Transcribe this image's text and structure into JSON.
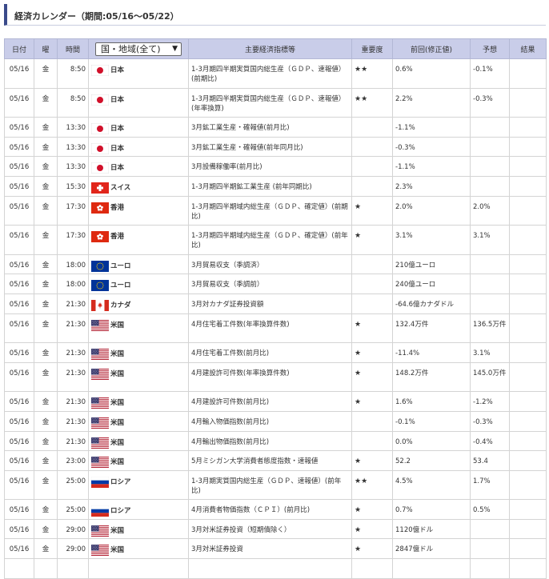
{
  "title": "経済カレンダー（期間:05/16〜05/22）",
  "headers": {
    "date": "日付",
    "dow": "曜",
    "time": "時間",
    "region_select": "国・地域(全て)",
    "indicator": "主要経済指標等",
    "importance": "重要度",
    "previous": "前回(修正値)",
    "forecast": "予想",
    "result": "結果"
  },
  "rows": [
    {
      "date": "05/16",
      "dow": "金",
      "time": "8:50",
      "flag": "japan-flag",
      "country": "日本",
      "indicator": "1-3月期四半期実質国内総生産（ＧＤＰ、速報値）(前期比)",
      "importance": "★★",
      "previous": "0.6%",
      "forecast": "-0.1%",
      "result": ""
    },
    {
      "date": "05/16",
      "dow": "金",
      "time": "8:50",
      "flag": "japan-flag",
      "country": "日本",
      "indicator": "1-3月期四半期実質国内総生産（ＧＤＰ、速報値）(年率換算)",
      "importance": "★★",
      "previous": "2.2%",
      "forecast": "-0.3%",
      "result": ""
    },
    {
      "date": "05/16",
      "dow": "金",
      "time": "13:30",
      "flag": "japan-flag",
      "country": "日本",
      "indicator": "3月鉱工業生産・確報値(前月比)",
      "importance": "",
      "previous": "-1.1%",
      "forecast": "",
      "result": ""
    },
    {
      "date": "05/16",
      "dow": "金",
      "time": "13:30",
      "flag": "japan-flag",
      "country": "日本",
      "indicator": "3月鉱工業生産・確報値(前年同月比)",
      "importance": "",
      "previous": "-0.3%",
      "forecast": "",
      "result": ""
    },
    {
      "date": "05/16",
      "dow": "金",
      "time": "13:30",
      "flag": "japan-flag",
      "country": "日本",
      "indicator": "3月設備稼働率(前月比)",
      "importance": "",
      "previous": "-1.1%",
      "forecast": "",
      "result": ""
    },
    {
      "date": "05/16",
      "dow": "金",
      "time": "15:30",
      "flag": "switzerland-flag",
      "country": "スイス",
      "indicator": "1-3月期四半期鉱工業生産 (前年同期比)",
      "importance": "",
      "previous": "2.3%",
      "forecast": "",
      "result": ""
    },
    {
      "date": "05/16",
      "dow": "金",
      "time": "17:30",
      "flag": "hong-kong-flag",
      "country": "香港",
      "indicator": "1-3月期四半期域内総生産（ＧＤＰ、確定値）(前期比)",
      "importance": "★",
      "previous": "2.0%",
      "forecast": "2.0%",
      "result": ""
    },
    {
      "date": "05/16",
      "dow": "金",
      "time": "17:30",
      "flag": "hong-kong-flag",
      "country": "香港",
      "indicator": "1-3月期四半期域内総生産（ＧＤＰ、確定値）(前年比)",
      "importance": "★",
      "previous": "3.1%",
      "forecast": "3.1%",
      "result": ""
    },
    {
      "date": "05/16",
      "dow": "金",
      "time": "18:00",
      "flag": "eu-flag",
      "country": "ユーロ",
      "indicator": "3月貿易収支（季調済）",
      "importance": "",
      "previous": "210億ユーロ",
      "forecast": "",
      "result": ""
    },
    {
      "date": "05/16",
      "dow": "金",
      "time": "18:00",
      "flag": "eu-flag",
      "country": "ユーロ",
      "indicator": "3月貿易収支（季調前）",
      "importance": "",
      "previous": "240億ユーロ",
      "forecast": "",
      "result": ""
    },
    {
      "date": "05/16",
      "dow": "金",
      "time": "21:30",
      "flag": "canada-flag",
      "country": "カナダ",
      "indicator": "3月対カナダ証券投資額",
      "importance": "",
      "previous": "-64.6億カナダドル",
      "forecast": "",
      "result": ""
    },
    {
      "date": "05/16",
      "dow": "金",
      "time": "21:30",
      "flag": "us-flag",
      "country": "米国",
      "indicator": "4月住宅着工件数(年率換算件数)",
      "importance": "★",
      "previous": "132.4万件",
      "forecast": "136.5万件",
      "result": ""
    },
    {
      "date": "05/16",
      "dow": "金",
      "time": "21:30",
      "flag": "us-flag",
      "country": "米国",
      "indicator": "4月住宅着工件数(前月比)",
      "importance": "★",
      "previous": "-11.4%",
      "forecast": "3.1%",
      "result": ""
    },
    {
      "date": "05/16",
      "dow": "金",
      "time": "21:30",
      "flag": "us-flag",
      "country": "米国",
      "indicator": "4月建設許可件数(年率換算件数)",
      "importance": "★",
      "previous": "148.2万件",
      "forecast": "145.0万件",
      "result": ""
    },
    {
      "date": "05/16",
      "dow": "金",
      "time": "21:30",
      "flag": "us-flag",
      "country": "米国",
      "indicator": "4月建設許可件数(前月比)",
      "importance": "★",
      "previous": "1.6%",
      "forecast": "-1.2%",
      "result": ""
    },
    {
      "date": "05/16",
      "dow": "金",
      "time": "21:30",
      "flag": "us-flag",
      "country": "米国",
      "indicator": "4月輸入物価指数(前月比)",
      "importance": "",
      "previous": "-0.1%",
      "forecast": "-0.3%",
      "result": ""
    },
    {
      "date": "05/16",
      "dow": "金",
      "time": "21:30",
      "flag": "us-flag",
      "country": "米国",
      "indicator": "4月輸出物価指数(前月比)",
      "importance": "",
      "previous": "0.0%",
      "forecast": "-0.4%",
      "result": ""
    },
    {
      "date": "05/16",
      "dow": "金",
      "time": "23:00",
      "flag": "us-flag",
      "country": "米国",
      "indicator": "5月ミシガン大学消費者態度指数・速報値",
      "importance": "★",
      "previous": "52.2",
      "forecast": "53.4",
      "result": ""
    },
    {
      "date": "05/16",
      "dow": "金",
      "time": "25:00",
      "flag": "russia-flag",
      "country": "ロシア",
      "indicator": "1-3月期実質国内総生産（ＧＤＰ、速報値）(前年比)",
      "importance": "★★",
      "previous": "4.5%",
      "forecast": "1.7%",
      "result": ""
    },
    {
      "date": "05/16",
      "dow": "金",
      "time": "25:00",
      "flag": "russia-flag",
      "country": "ロシア",
      "indicator": "4月消費者物価指数（ＣＰＩ）(前月比)",
      "importance": "★",
      "previous": "0.7%",
      "forecast": "0.5%",
      "result": ""
    },
    {
      "date": "05/16",
      "dow": "金",
      "time": "29:00",
      "flag": "us-flag",
      "country": "米国",
      "indicator": "3月対米証券投資（短期債除く）",
      "importance": "★",
      "previous": "1120億ドル",
      "forecast": "",
      "result": ""
    },
    {
      "date": "05/16",
      "dow": "金",
      "time": "29:00",
      "flag": "us-flag",
      "country": "米国",
      "indicator": "3月対米証券投資",
      "importance": "★",
      "previous": "2847億ドル",
      "forecast": "",
      "result": ""
    },
    {
      "date": "",
      "dow": "",
      "time": "",
      "flag": "",
      "country": "",
      "indicator": "",
      "importance": "",
      "previous": "",
      "forecast": "",
      "result": ""
    }
  ]
}
